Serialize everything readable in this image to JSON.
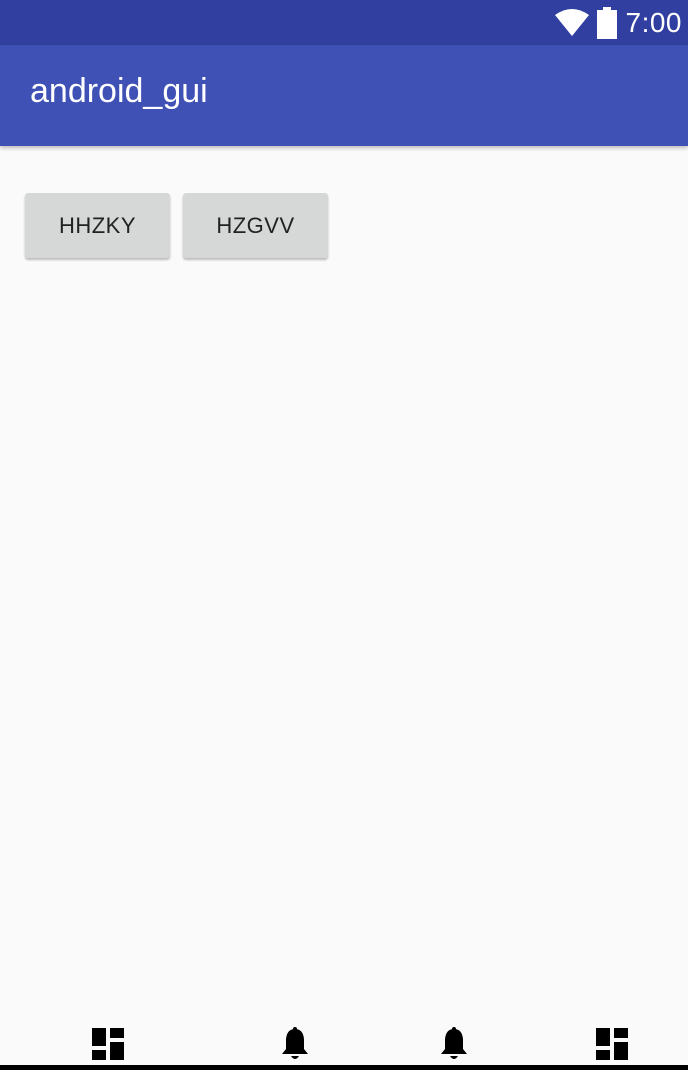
{
  "status_bar": {
    "time": "7:00",
    "icons": [
      "wifi-icon",
      "battery-icon"
    ]
  },
  "app_bar": {
    "title": "android_gui"
  },
  "buttons": [
    {
      "label": "HHZKY"
    },
    {
      "label": "HZGVV"
    }
  ],
  "bottom_nav": {
    "items": [
      {
        "icon": "dashboard-icon"
      },
      {
        "icon": "notifications-icon"
      },
      {
        "icon": "notifications-icon"
      },
      {
        "icon": "dashboard-icon"
      }
    ]
  },
  "colors": {
    "status_bar": "#3140a0",
    "app_bar": "#3f51b5",
    "background": "#fafafa",
    "button": "#d6d7d7"
  }
}
